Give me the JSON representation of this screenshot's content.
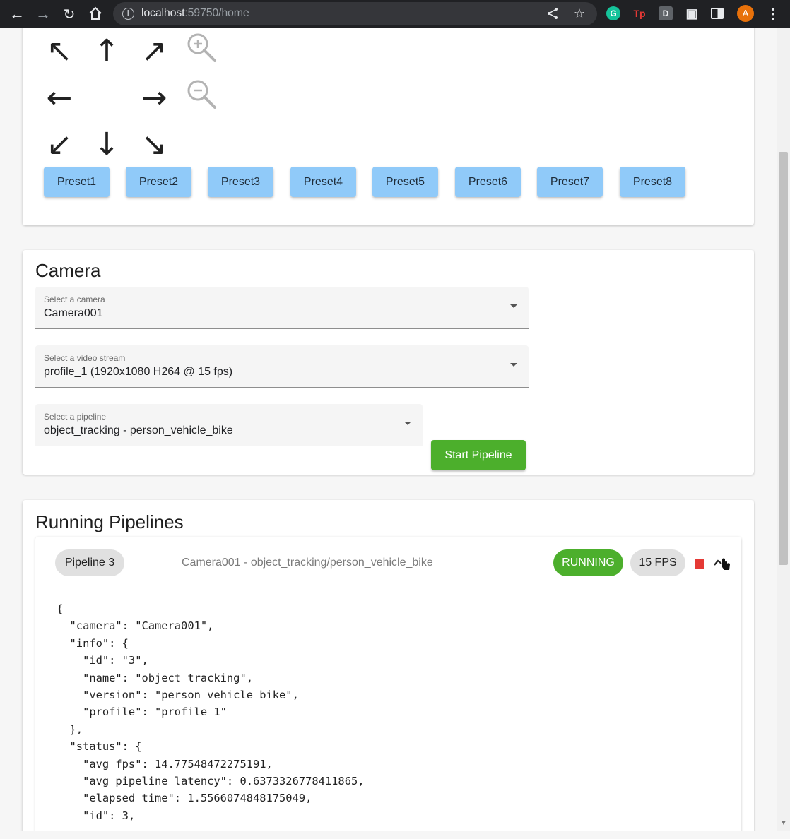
{
  "browser": {
    "url_host": "localhost",
    "url_rest": ":59750/home",
    "avatar_letter": "A",
    "extensions": {
      "grammarly": "G",
      "tp": "Tp",
      "d": "D"
    }
  },
  "ptz": {
    "presets": [
      "Preset1",
      "Preset2",
      "Preset3",
      "Preset4",
      "Preset5",
      "Preset6",
      "Preset7",
      "Preset8"
    ],
    "preset_color": "#90caf9"
  },
  "camera": {
    "title": "Camera",
    "camera_select": {
      "label": "Select a camera",
      "value": "Camera001"
    },
    "stream_select": {
      "label": "Select a video stream",
      "value": "profile_1 (1920x1080 H264 @ 15 fps)"
    },
    "pipeline_select": {
      "label": "Select a pipeline",
      "value": "object_tracking - person_vehicle_bike"
    },
    "start_button": "Start Pipeline",
    "accent": "#4caf2c"
  },
  "running": {
    "title": "Running Pipelines",
    "pipeline": {
      "name": "Pipeline 3",
      "description": "Camera001 - object_tracking/person_vehicle_bike",
      "status": "RUNNING",
      "fps": "15 FPS",
      "json_lines": [
        "{",
        "  \"camera\": \"Camera001\",",
        "  \"info\": {",
        "    \"id\": \"3\",",
        "    \"name\": \"object_tracking\",",
        "    \"version\": \"person_vehicle_bike\",",
        "    \"profile\": \"profile_1\"",
        "  },",
        "  \"status\": {",
        "    \"avg_fps\": 14.77548472275191,",
        "    \"avg_pipeline_latency\": 0.6373326778411865,",
        "    \"elapsed_time\": 1.5566074848175049,",
        "    \"id\": 3,"
      ]
    }
  }
}
